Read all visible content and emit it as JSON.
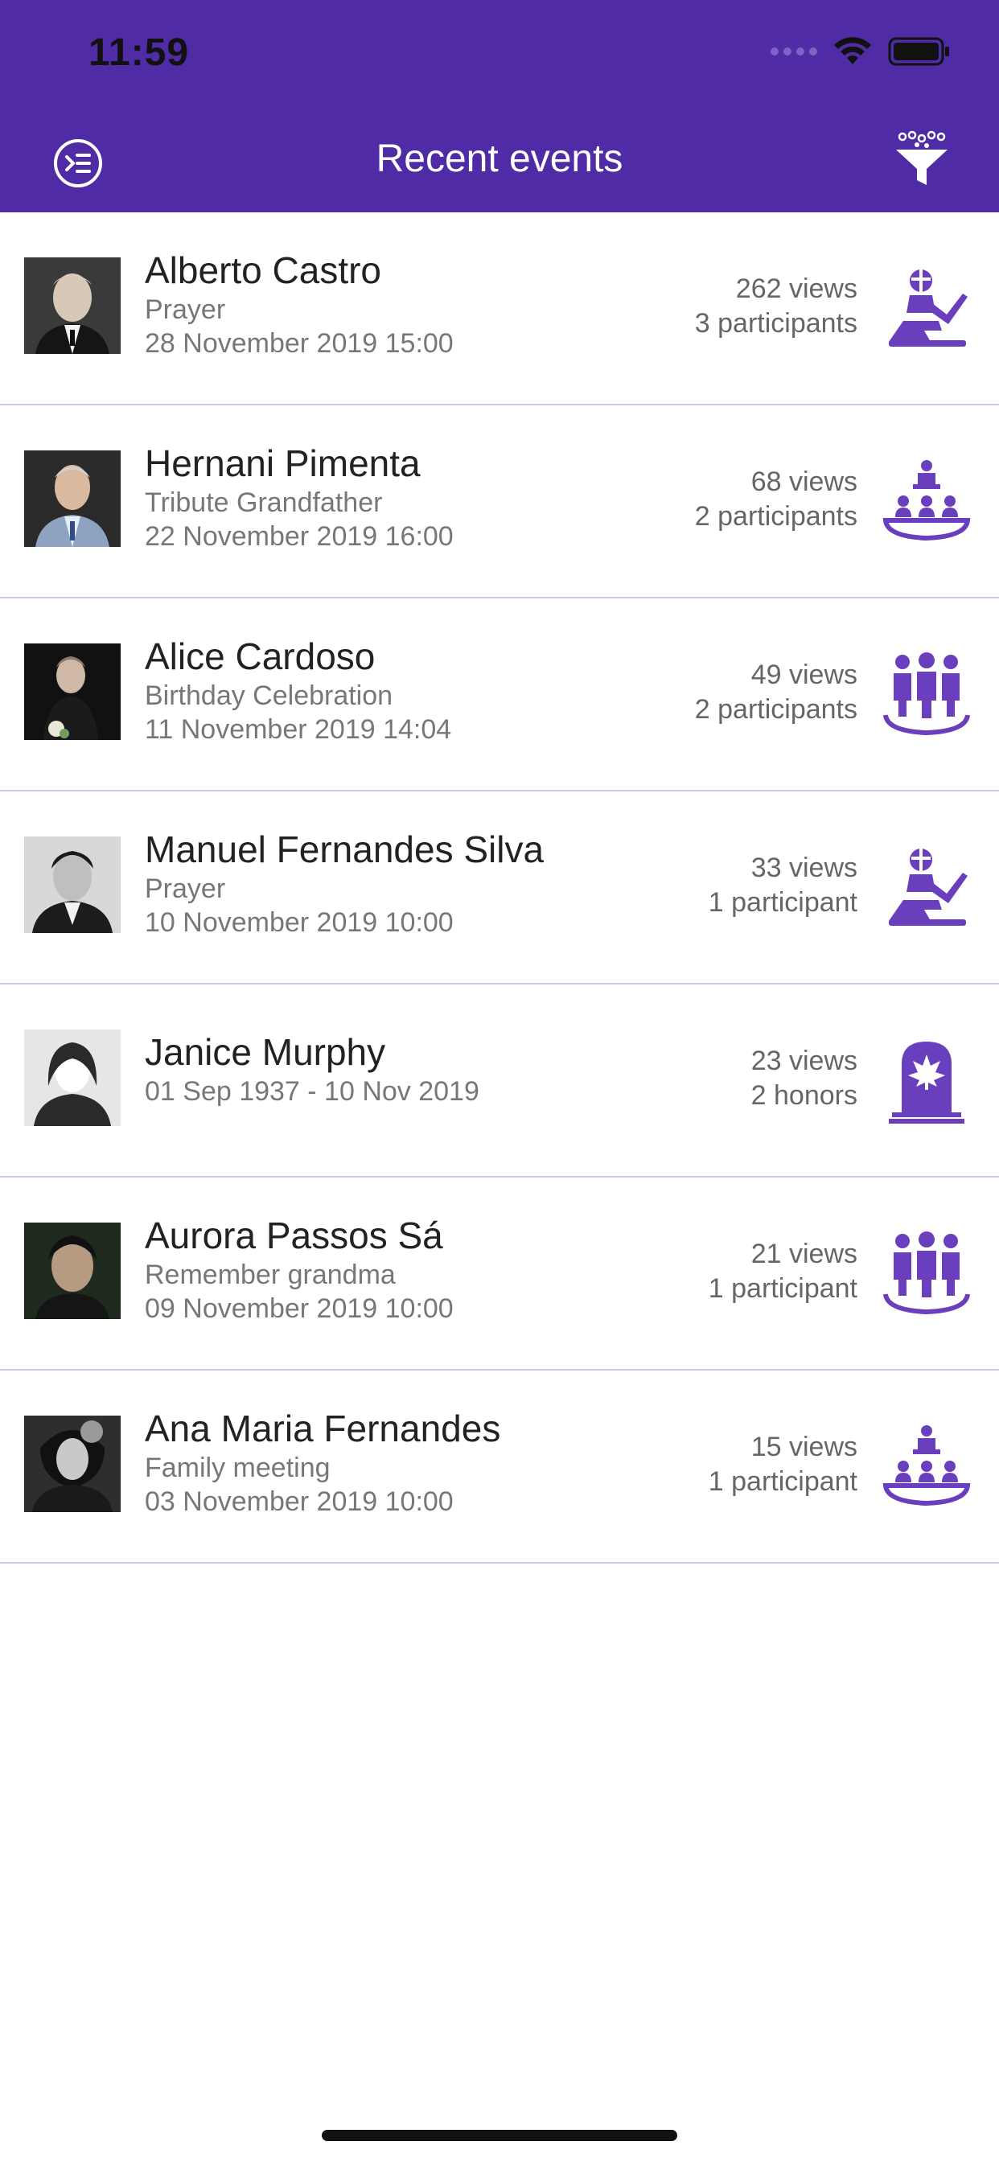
{
  "status_bar": {
    "time": "11:59"
  },
  "header": {
    "title": "Recent events",
    "left_icon": "sidebar-menu-icon",
    "right_icon": "filter-funnel-icon"
  },
  "colors": {
    "accent": "#4f2ca6",
    "icon": "#6a3fbd"
  },
  "events": [
    {
      "name": "Alberto Castro",
      "subtitle": "Prayer",
      "date": "28 November 2019 15:00",
      "views": "262 views",
      "participants": "3 participants",
      "icon": "prayer-icon"
    },
    {
      "name": "Hernani Pimenta",
      "subtitle": "Tribute Grandfather",
      "date": "22 November 2019 16:00",
      "views": "68 views",
      "participants": "2 participants",
      "icon": "tribute-icon"
    },
    {
      "name": "Alice Cardoso",
      "subtitle": "Birthday Celebration",
      "date": "11 November 2019 14:04",
      "views": "49 views",
      "participants": "2 participants",
      "icon": "celebration-group-icon"
    },
    {
      "name": "Manuel Fernandes Silva",
      "subtitle": "Prayer",
      "date": "10 November 2019 10:00",
      "views": "33 views",
      "participants": "1 participant",
      "icon": "prayer-icon"
    },
    {
      "name": "Janice Murphy",
      "subtitle": "01 Sep 1937 - 10 Nov 2019",
      "date": "",
      "views": "23 views",
      "participants": "2 honors",
      "icon": "tombstone-icon"
    },
    {
      "name": "Aurora Passos Sá",
      "subtitle": "Remember grandma",
      "date": "09 November 2019 10:00",
      "views": "21 views",
      "participants": "1 participant",
      "icon": "celebration-group-icon"
    },
    {
      "name": "Ana Maria Fernandes",
      "subtitle": "Family meeting",
      "date": "03 November 2019 10:00",
      "views": "15 views",
      "participants": "1 participant",
      "icon": "tribute-icon"
    }
  ]
}
